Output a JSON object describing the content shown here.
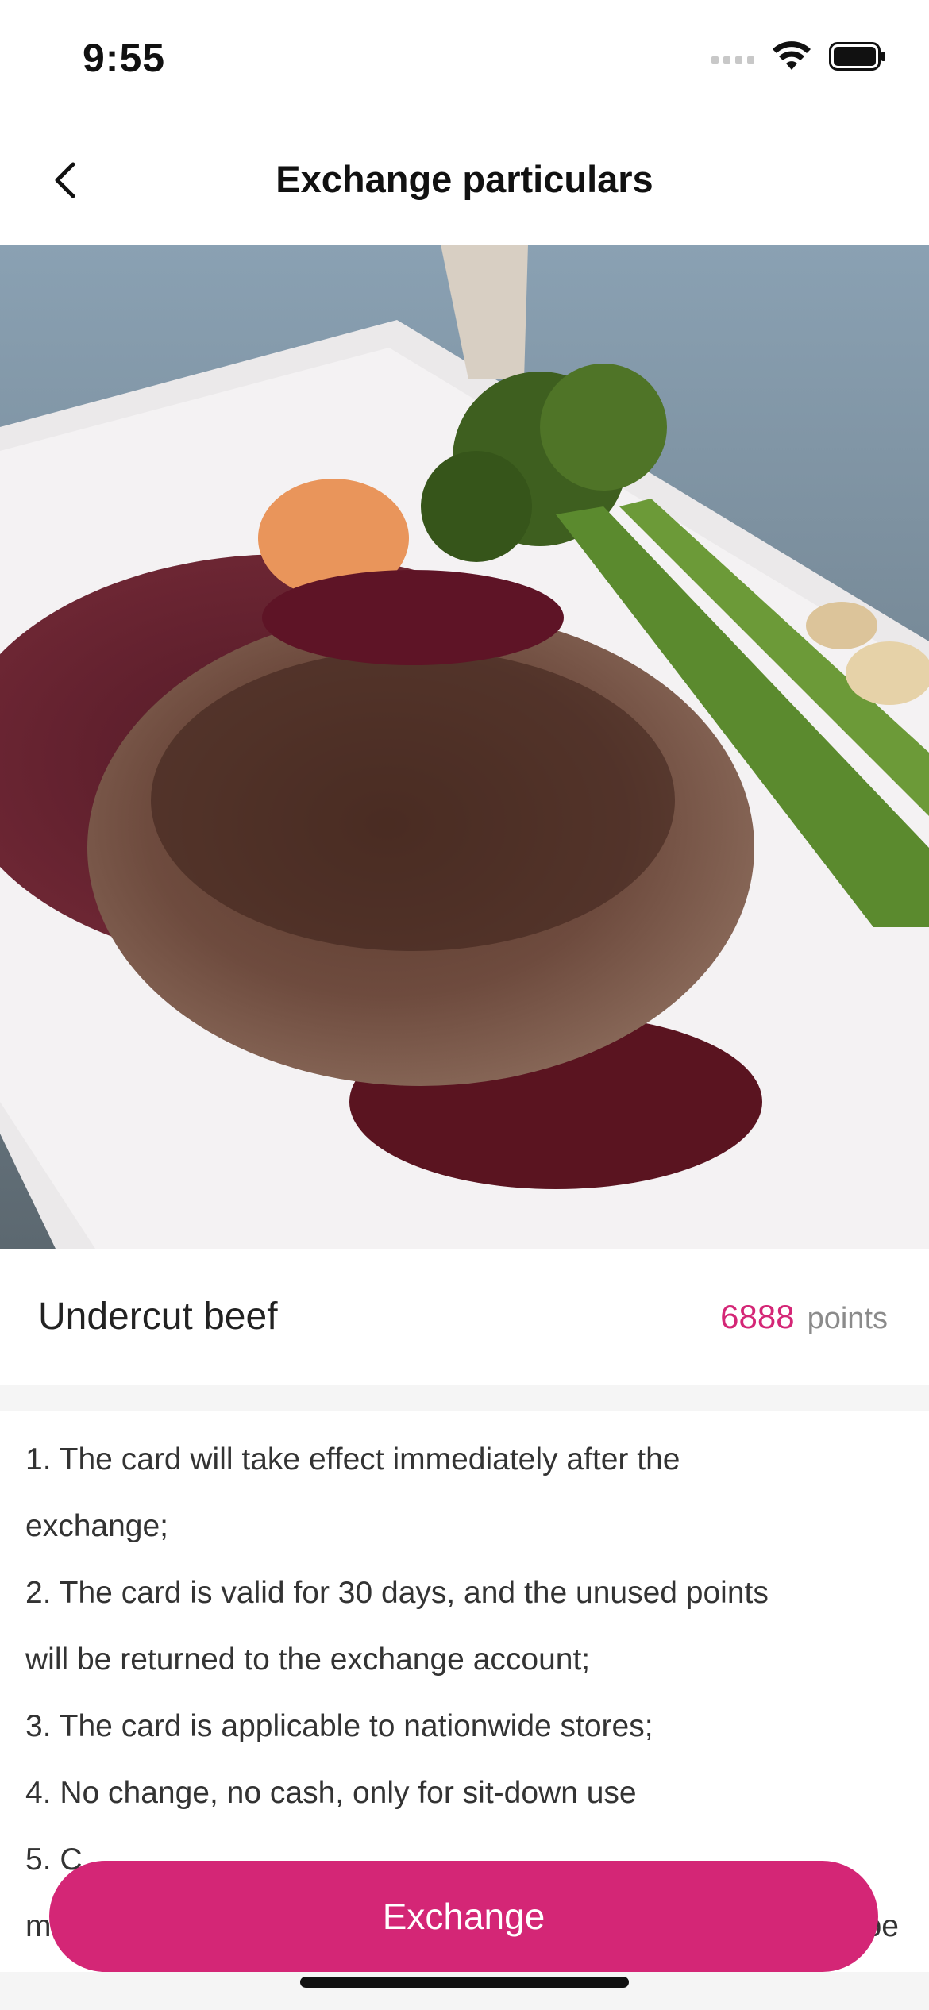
{
  "status_bar": {
    "time": "9:55"
  },
  "nav": {
    "title": "Exchange particulars",
    "back_icon": "chevron-left-icon"
  },
  "carousel": {
    "total_slides": 3,
    "active_index": 0,
    "active_color": "#f5a21a"
  },
  "item": {
    "name": "Undercut beef",
    "points_value": "6888",
    "points_unit": "points",
    "accent": "#d42676"
  },
  "rules": [
    "1. The card will take effect immediately after the",
    "exchange;",
    "2. The card is valid for 30 days, and the unused points",
    "will be returned to the exchange account;",
    "3. The card is applicable to nationwide stores;",
    "4. No change, no cash, only for sit-down use",
    "5. C",
    "ma"
  ],
  "rules_overflow_tail": "be",
  "button": {
    "label": "Exchange",
    "color": "#d42676"
  }
}
